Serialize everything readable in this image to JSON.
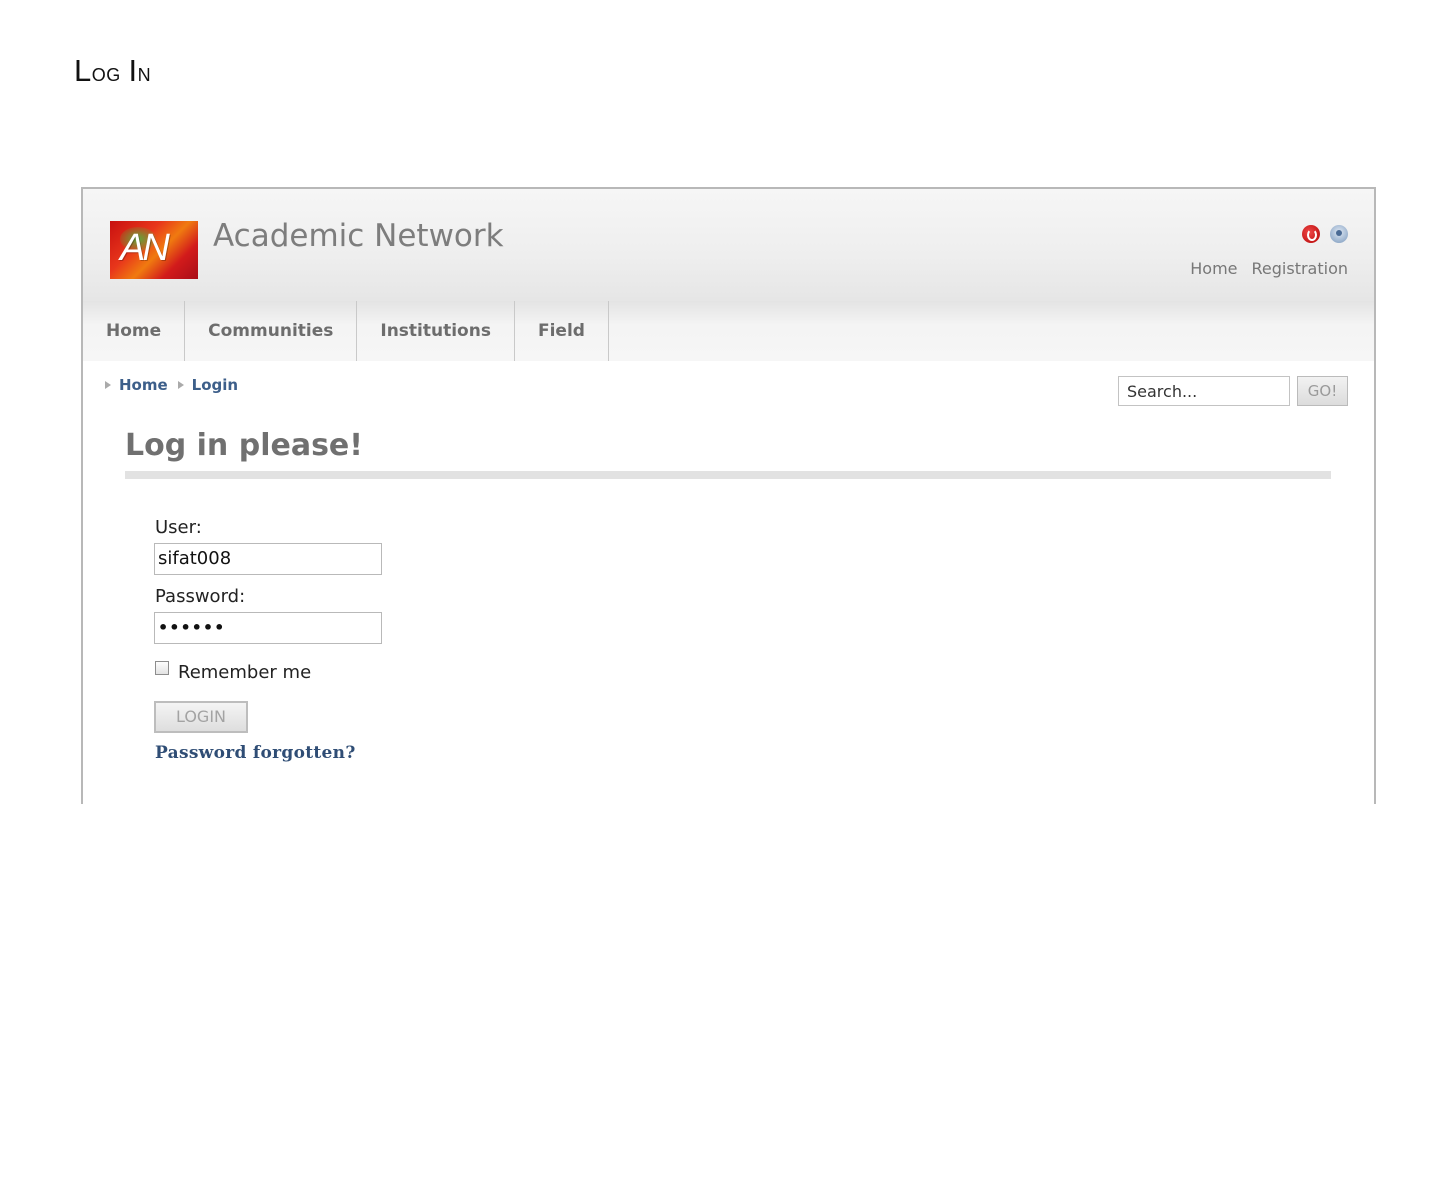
{
  "document": {
    "heading_first_cap": "L",
    "heading_rest_1": "og ",
    "heading_second_cap": "I",
    "heading_rest_2": "n"
  },
  "site": {
    "logo_text": "AN",
    "title": "Academic Network",
    "accent_color": "#d21b1b",
    "link_color": "#3d5f8a"
  },
  "top_icons": [
    "power-icon",
    "user-icon"
  ],
  "top_links": {
    "home": "Home",
    "registration": "Registration"
  },
  "nav": {
    "items": [
      {
        "label": "Home"
      },
      {
        "label": "Communities"
      },
      {
        "label": "Institutions"
      },
      {
        "label": "Field"
      }
    ]
  },
  "breadcrumb": {
    "items": [
      {
        "label": "Home"
      },
      {
        "label": "Login"
      }
    ]
  },
  "search": {
    "value": "Search...",
    "button_label": "GO!"
  },
  "login_form": {
    "title": "Log in please!",
    "user_label": "User:",
    "user_value": "sifat008",
    "password_label": "Password:",
    "password_value": "••••••",
    "remember_label": "Remember me",
    "remember_checked": false,
    "submit_label": "LOGIN",
    "forgot_label": "Password forgotten?"
  }
}
